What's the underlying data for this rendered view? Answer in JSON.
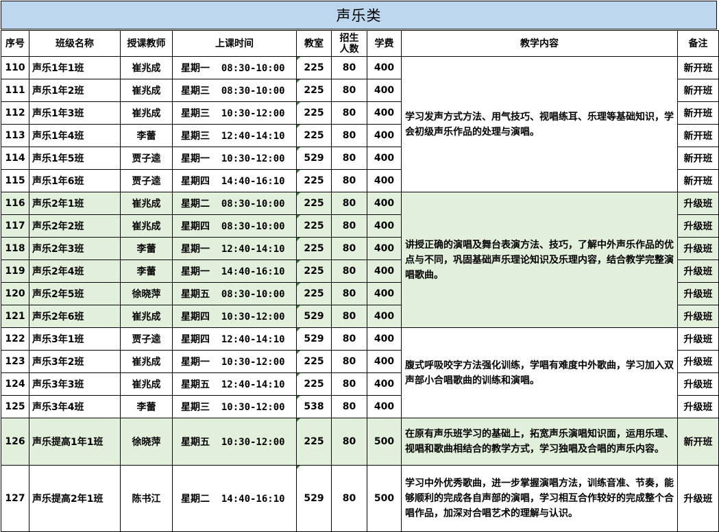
{
  "title": "声乐类",
  "headers": {
    "no": "序号",
    "class_name": "班级名称",
    "teacher": "授课教师",
    "time": "上课时间",
    "room": "教室",
    "enroll_line1": "招生",
    "enroll_line2": "人数",
    "fee": "学费",
    "content": "教学内容",
    "note": "备注"
  },
  "rows": [
    {
      "no": "110",
      "name": "声乐1年1班",
      "teacher": "崔兆成",
      "time": "星期一  08:30-10:00",
      "room": "225",
      "enroll": "80",
      "fee": "400",
      "note": "新开班"
    },
    {
      "no": "111",
      "name": "声乐1年2班",
      "teacher": "崔兆成",
      "time": "星期三  08:30-10:00",
      "room": "225",
      "enroll": "80",
      "fee": "400",
      "note": "新开班"
    },
    {
      "no": "112",
      "name": "声乐1年3班",
      "teacher": "崔兆成",
      "time": "星期三  10:30-12:00",
      "room": "225",
      "enroll": "80",
      "fee": "400",
      "note": "新开班"
    },
    {
      "no": "113",
      "name": "声乐1年4班",
      "teacher": "李蕾",
      "time": "星期三  12:40-14:10",
      "room": "225",
      "enroll": "80",
      "fee": "400",
      "note": "新开班"
    },
    {
      "no": "114",
      "name": "声乐1年5班",
      "teacher": "贾子逵",
      "time": "星期一  10:30-12:00",
      "room": "529",
      "enroll": "80",
      "fee": "400",
      "note": "新开班"
    },
    {
      "no": "115",
      "name": "声乐1年6班",
      "teacher": "贾子逵",
      "time": "星期四  14:40-16:10",
      "room": "225",
      "enroll": "80",
      "fee": "400",
      "note": "新开班"
    },
    {
      "no": "116",
      "name": "声乐2年1班",
      "teacher": "崔兆成",
      "time": "星期二  08:30-10:00",
      "room": "225",
      "enroll": "80",
      "fee": "400",
      "note": "升级班"
    },
    {
      "no": "117",
      "name": "声乐2年2班",
      "teacher": "崔兆成",
      "time": "星期四  08:30-10:00",
      "room": "225",
      "enroll": "80",
      "fee": "400",
      "note": "升级班"
    },
    {
      "no": "118",
      "name": "声乐2年3班",
      "teacher": "李蕾",
      "time": "星期一  12:40-14:10",
      "room": "225",
      "enroll": "80",
      "fee": "400",
      "note": "升级班"
    },
    {
      "no": "119",
      "name": "声乐2年4班",
      "teacher": "李蕾",
      "time": "星期一  14:40-16:10",
      "room": "225",
      "enroll": "80",
      "fee": "400",
      "note": "升级班"
    },
    {
      "no": "120",
      "name": "声乐2年5班",
      "teacher": "徐晓萍",
      "time": "星期五  08:30-10:00",
      "room": "225",
      "enroll": "80",
      "fee": "400",
      "note": "升级班"
    },
    {
      "no": "121",
      "name": "声乐2年6班",
      "teacher": "崔兆成",
      "time": "星期四  10:30-12:00",
      "room": "529",
      "enroll": "80",
      "fee": "400",
      "note": "升级班"
    },
    {
      "no": "122",
      "name": "声乐3年1班",
      "teacher": "贾子逵",
      "time": "星期四  12:40-14:10",
      "room": "529",
      "enroll": "80",
      "fee": "400",
      "note": "升级班"
    },
    {
      "no": "123",
      "name": "声乐3年2班",
      "teacher": "崔兆成",
      "time": "星期一  10:30-12:00",
      "room": "225",
      "enroll": "80",
      "fee": "400",
      "note": "升级班"
    },
    {
      "no": "124",
      "name": "声乐3年3班",
      "teacher": "崔兆成",
      "time": "星期五  12:40-14:10",
      "room": "225",
      "enroll": "80",
      "fee": "400",
      "note": "升级班"
    },
    {
      "no": "125",
      "name": "声乐3年4班",
      "teacher": "李蕾",
      "time": "星期三  10:30-12:00",
      "room": "538",
      "enroll": "80",
      "fee": "400",
      "note": "升级班"
    },
    {
      "no": "126",
      "name": "声乐提高1年1班",
      "teacher": "徐晓萍",
      "time": "星期五  10:30-12:00",
      "room": "225",
      "enroll": "80",
      "fee": "500",
      "note": "新开班"
    },
    {
      "no": "127",
      "name": "声乐提高2年1班",
      "teacher": "陈书江",
      "time": "星期二  14:40-16:10",
      "room": "529",
      "enroll": "80",
      "fee": "500",
      "note": "升级班"
    }
  ],
  "contents": {
    "year1": "学习发声方式方法、用气技巧、视唱练耳、乐理等基础知识，学会初级声乐作品的处理与演唱。",
    "year2": "讲授正确的演唱及舞台表演方法、技巧，了解中外声乐作品的优点与不同，巩固基础声乐理论知识及乐理内容，结合教学完整演唱歌曲。",
    "year3": "腹式呼吸咬字方法强化训练，学唱有难度中外歌曲，学习加入双声部小合唱歌曲的训练和演唱。",
    "adv1": "在原有声乐班学习的基础上，拓宽声乐演唱知识面，运用乐理、视唱和歌曲相结合的教学方式，学习独唱及合唱的声乐内容。",
    "adv2": "学习中外优秀歌曲，进一步掌握演唱方法，训练音准、节奏，能够顺利的完成各自声部的演唱，学习相互合作较好的完成整个合唱作品，加深对合唱艺术的理解与认识。"
  },
  "colors": {
    "title_bg": "#bdd7ee",
    "band_green": "#e2efda",
    "band_white": "#ffffff"
  }
}
